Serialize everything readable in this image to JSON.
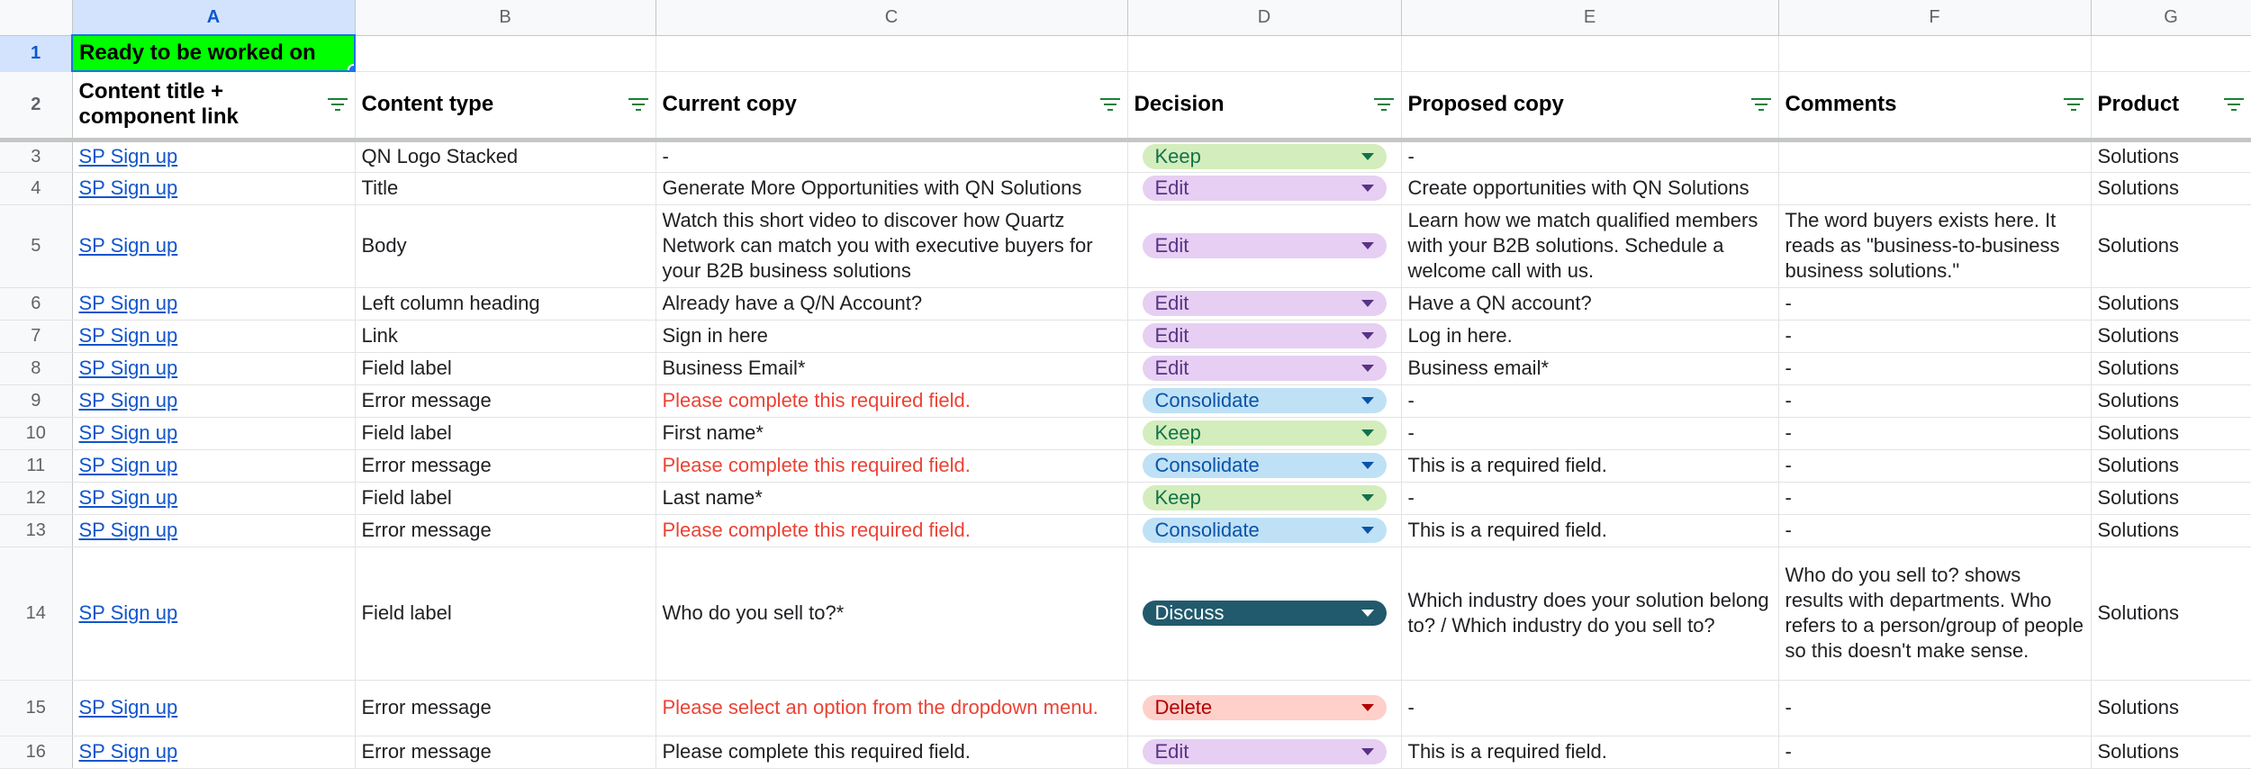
{
  "columns": [
    "A",
    "B",
    "C",
    "D",
    "E",
    "F",
    "G"
  ],
  "row1": {
    "number": "1",
    "banner": "Ready to be worked on"
  },
  "header": {
    "number": "2",
    "cells": [
      "Content title + component link",
      "Content type",
      "Current copy",
      "Decision",
      "Proposed copy",
      "Comments",
      "Product"
    ]
  },
  "rows": [
    {
      "n": "3",
      "title": "SP Sign up",
      "type": "QN Logo Stacked",
      "current": "-",
      "current_red": false,
      "decision": "Keep",
      "proposed": "-",
      "comments": "",
      "product": "Solutions"
    },
    {
      "n": "4",
      "title": "SP Sign up",
      "type": "Title",
      "current": "Generate More Opportunities with QN Solutions",
      "current_red": false,
      "decision": "Edit",
      "proposed": "Create opportunities with QN Solutions",
      "comments": "",
      "product": "Solutions"
    },
    {
      "n": "5",
      "title": "SP Sign up",
      "type": "Body",
      "current": "Watch this short video to discover how Quartz Network can match you with executive buyers for your B2B business solutions",
      "current_red": false,
      "decision": "Edit",
      "proposed": "Learn how we match qualified members with your B2B solutions. Schedule a welcome call with us.",
      "comments": "The word buyers exists here. It reads as \"business-to-business business solutions.\"",
      "product": "Solutions"
    },
    {
      "n": "6",
      "title": "SP Sign up",
      "type": "Left column heading",
      "current": "Already have a Q/N Account?",
      "current_red": false,
      "decision": "Edit",
      "proposed": "Have a QN account?",
      "comments": "-",
      "product": "Solutions"
    },
    {
      "n": "7",
      "title": "SP Sign up",
      "type": "Link",
      "current": "Sign in here",
      "current_red": false,
      "decision": "Edit",
      "proposed": "Log in here.",
      "comments": "-",
      "product": "Solutions"
    },
    {
      "n": "8",
      "title": "SP Sign up",
      "type": "Field label",
      "current": "Business Email*",
      "current_red": false,
      "decision": "Edit",
      "proposed": "Business email*",
      "comments": "-",
      "product": "Solutions"
    },
    {
      "n": "9",
      "title": "SP Sign up",
      "type": "Error message",
      "current": "Please complete this required field.",
      "current_red": true,
      "decision": "Consolidate",
      "proposed": "-",
      "comments": "-",
      "product": "Solutions"
    },
    {
      "n": "10",
      "title": "SP Sign up",
      "type": "Field label",
      "current": "First name*",
      "current_red": false,
      "decision": "Keep",
      "proposed": "-",
      "comments": "-",
      "product": "Solutions"
    },
    {
      "n": "11",
      "title": "SP Sign up",
      "type": "Error message",
      "current": "Please complete this required field.",
      "current_red": true,
      "decision": "Consolidate",
      "proposed": "This is a required field.",
      "comments": "-",
      "product": "Solutions"
    },
    {
      "n": "12",
      "title": "SP Sign up",
      "type": "Field label",
      "current": "Last name*",
      "current_red": false,
      "decision": "Keep",
      "proposed": "-",
      "comments": "-",
      "product": "Solutions"
    },
    {
      "n": "13",
      "title": "SP Sign up",
      "type": "Error message",
      "current": "Please complete this required field.",
      "current_red": true,
      "decision": "Consolidate",
      "proposed": "This is a required field.",
      "comments": "-",
      "product": "Solutions"
    },
    {
      "n": "14",
      "title": "SP Sign up",
      "type": "Field label",
      "current": "Who do you sell to?*",
      "current_red": false,
      "decision": "Discuss",
      "proposed": "Which industry does your solution belong to? / Which industry do you sell to?",
      "comments": "Who do you sell to? shows results with departments. Who refers to a person/group of people so this doesn't make sense.",
      "product": "Solutions"
    },
    {
      "n": "15",
      "title": "SP Sign up",
      "type": "Error message",
      "current": "Please select an option from the dropdown menu.",
      "current_red": true,
      "decision": "Delete",
      "proposed": "-",
      "comments": "-",
      "product": "Solutions"
    },
    {
      "n": "16",
      "title": "SP Sign up",
      "type": "Error message",
      "current": "Please complete this required field.",
      "current_red": false,
      "decision": "Edit",
      "proposed": "This is a required field.",
      "comments": "-",
      "product": "Solutions"
    }
  ],
  "chip_colors": {
    "Keep": "#d4edbc",
    "Edit": "#e6cff2",
    "Consolidate": "#bfe1f6",
    "Discuss": "#215a6c",
    "Delete": "#ffcfc9"
  }
}
